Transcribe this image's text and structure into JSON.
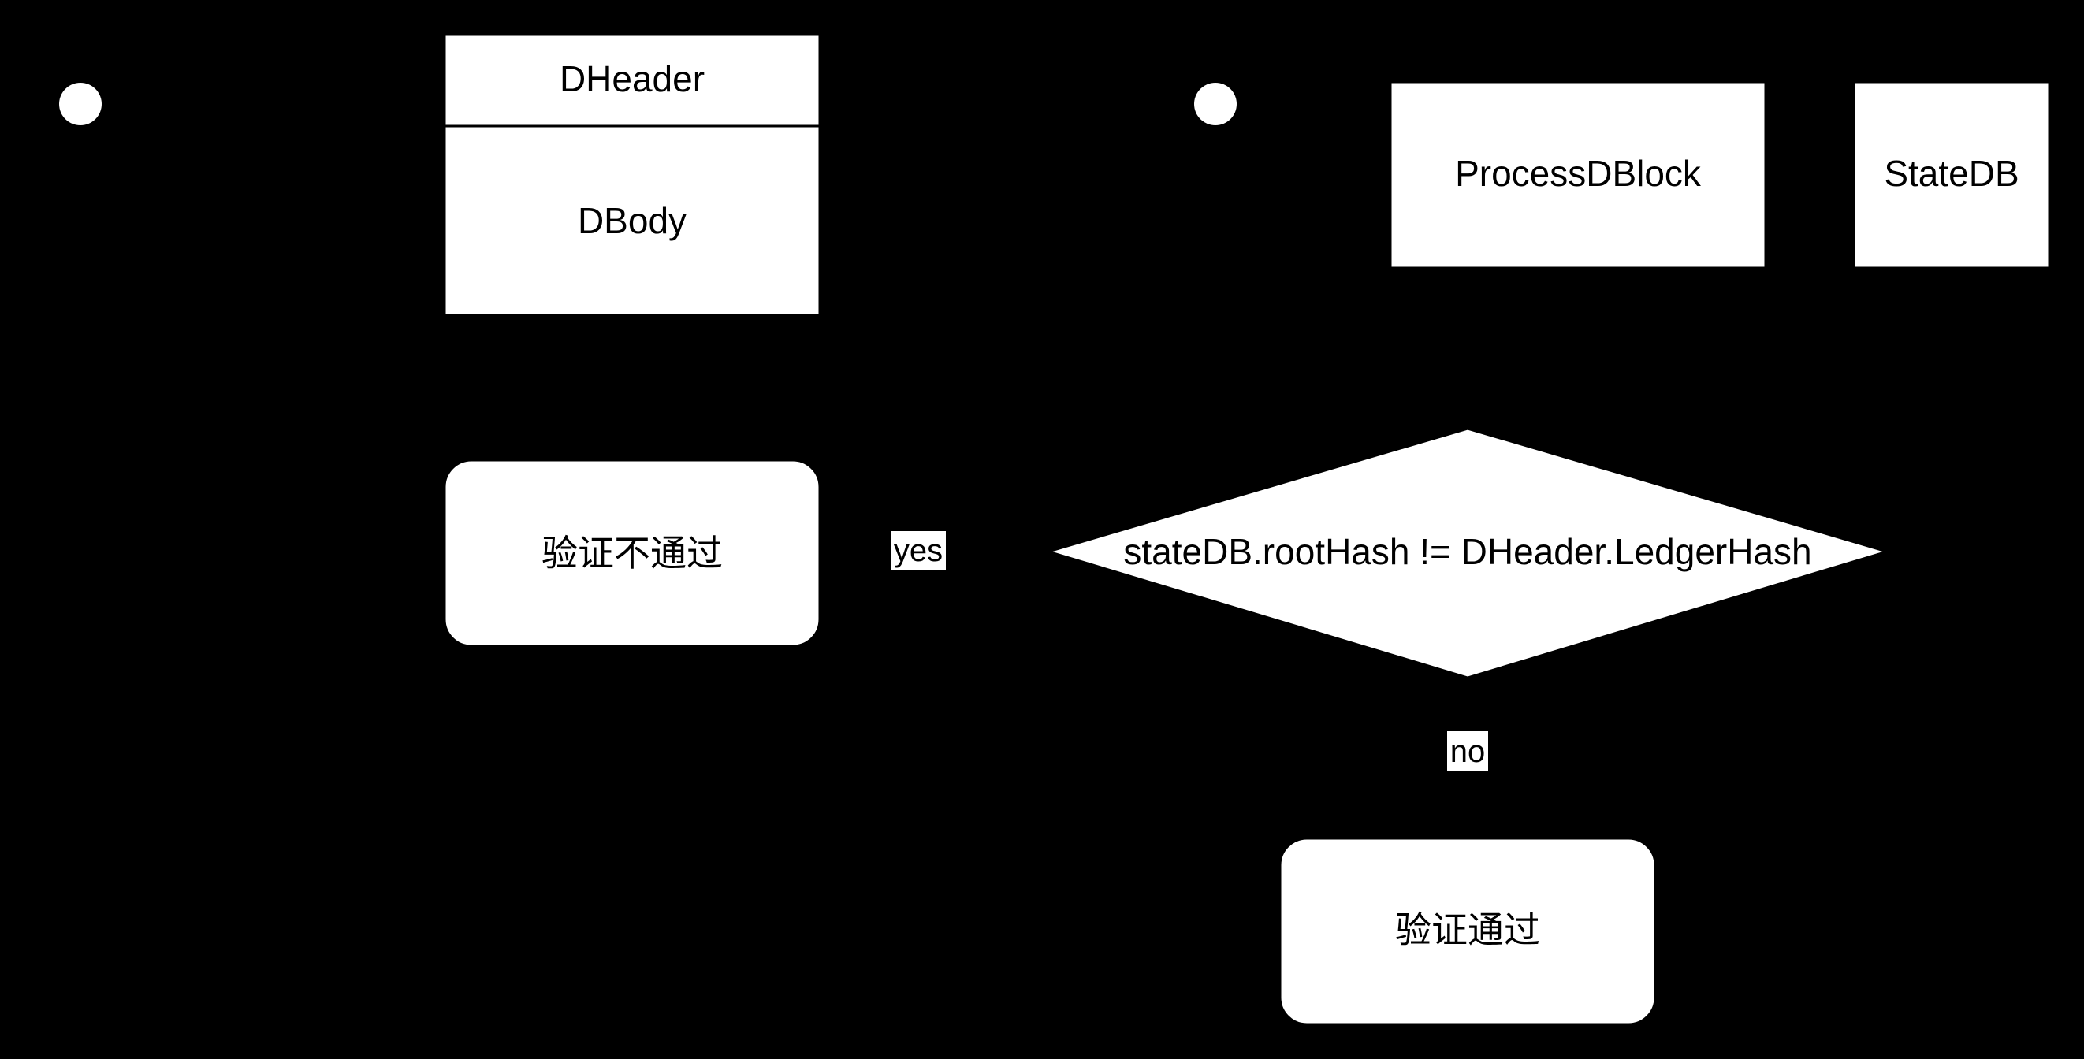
{
  "diagram": {
    "colors": {
      "background": "#000000",
      "node_fill": "#ffffff",
      "node_stroke": "#000000",
      "text": "#000000"
    },
    "nodes": {
      "start_left": {
        "shape": "start-circle"
      },
      "start_right": {
        "shape": "start-circle"
      },
      "dheader": {
        "label": "DHeader"
      },
      "dbody": {
        "label": "DBody"
      },
      "process_dblock": {
        "label": "ProcessDBlock"
      },
      "state_db": {
        "label": "StateDB"
      },
      "decision": {
        "label": "stateDB.rootHash != DHeader.LedgerHash"
      },
      "verify_fail": {
        "label": "验证不通过"
      },
      "verify_pass": {
        "label": "验证通过"
      }
    },
    "edges": {
      "yes": {
        "label": "yes"
      },
      "no": {
        "label": "no"
      }
    }
  }
}
